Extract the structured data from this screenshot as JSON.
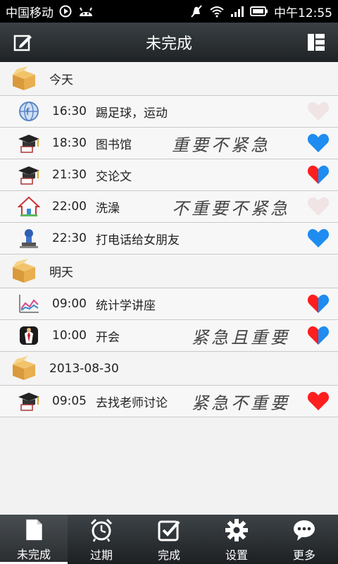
{
  "status_bar": {
    "carrier": "中国移动",
    "time": "中午12:55"
  },
  "header": {
    "title": "未完成"
  },
  "groups": [
    {
      "label": "今天",
      "items": [
        {
          "time": "16:30",
          "title": "踢足球，运动",
          "icon": "globe-icon",
          "note": "",
          "heart": "faded"
        },
        {
          "time": "18:30",
          "title": "图书馆",
          "icon": "graduation-cap-icon",
          "note": "重要不紧急",
          "heart": "blue"
        },
        {
          "time": "21:30",
          "title": "交论文",
          "icon": "graduation-cap-icon",
          "note": "",
          "heart": "red-blue"
        },
        {
          "time": "22:00",
          "title": "洗澡",
          "icon": "house-icon",
          "note": "不重要不紧急",
          "heart": "faded"
        },
        {
          "time": "22:30",
          "title": "打电话给女朋友",
          "icon": "stamp-icon",
          "note": "",
          "heart": "blue"
        }
      ]
    },
    {
      "label": "明天",
      "items": [
        {
          "time": "09:00",
          "title": "统计学讲座",
          "icon": "chart-icon",
          "note": "",
          "heart": "red-blue"
        },
        {
          "time": "10:00",
          "title": "开会",
          "icon": "suit-icon",
          "note": "紧急且重要",
          "heart": "red-blue"
        }
      ]
    },
    {
      "label": "2013-08-30",
      "items": [
        {
          "time": "09:05",
          "title": "去找老师讨论",
          "icon": "graduation-cap-icon",
          "note": "紧急不重要",
          "heart": "red"
        }
      ]
    }
  ],
  "tabs": [
    {
      "label": "未完成",
      "icon": "document-icon",
      "active": true
    },
    {
      "label": "过期",
      "icon": "alarm-clock-icon",
      "active": false
    },
    {
      "label": "完成",
      "icon": "checkbox-icon",
      "active": false
    },
    {
      "label": "设置",
      "icon": "gear-icon",
      "active": false
    },
    {
      "label": "更多",
      "icon": "chat-bubble-icon",
      "active": false
    }
  ],
  "colors": {
    "heart_red": "#ff1e1e",
    "heart_blue": "#1e8cf0",
    "heart_faded": "#f1e4e4"
  }
}
